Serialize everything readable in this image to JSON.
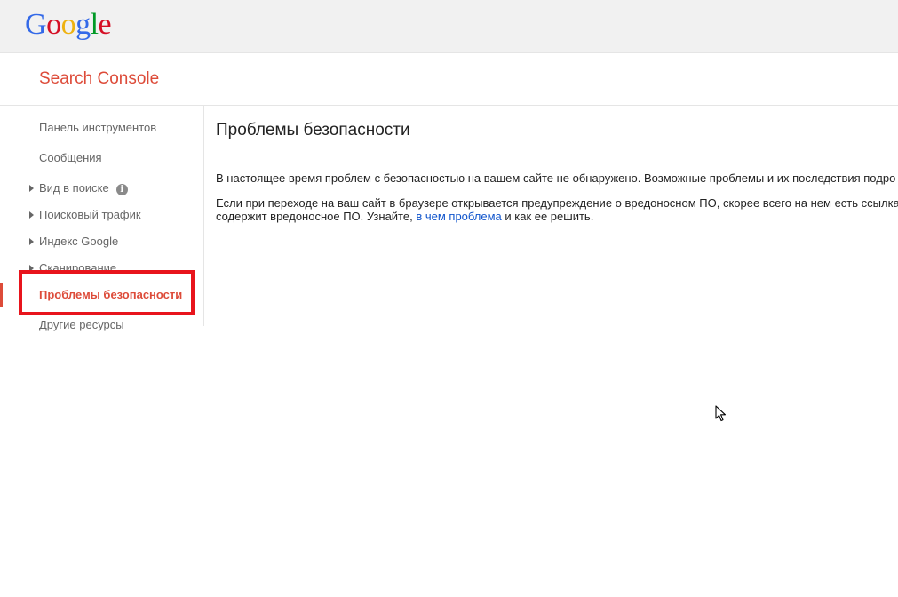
{
  "logo": {
    "letters": [
      "G",
      "o",
      "o",
      "g",
      "l",
      "e"
    ],
    "colors": [
      "#3369e8",
      "#d50f25",
      "#eeb211",
      "#3369e8",
      "#009925",
      "#d50f25"
    ]
  },
  "header": {
    "product_title": "Search Console"
  },
  "sidebar": {
    "items": [
      {
        "label": "Панель инструментов"
      },
      {
        "label": "Сообщения"
      },
      {
        "label": "Вид в поиске",
        "info_icon": "i"
      },
      {
        "label": "Поисковый трафик"
      },
      {
        "label": "Индекс Google"
      },
      {
        "label": "Сканирование"
      },
      {
        "label": "Проблемы безопасности"
      },
      {
        "label": "Другие ресурсы"
      }
    ],
    "active_index": 6
  },
  "main": {
    "title": "Проблемы безопасности",
    "paragraph1": "В настоящее время проблем с безопасностью на вашем сайте не обнаружено. Возможные проблемы и их последствия подро",
    "paragraph2_line1": "Если при переходе на ваш сайт в браузере открывается предупреждение о вредоносном ПО, скорее всего на нем есть ссылка",
    "paragraph2_line2_before": "содержит вредоносное ПО. Узнайте, ",
    "paragraph2_link": "в чем проблема",
    "paragraph2_line2_after": " и как ее решить."
  },
  "colors": {
    "brand_red": "#dd4b39",
    "highlight_red": "#e8141c",
    "link_blue": "#1155cc",
    "topbar_bg": "#f1f1f1"
  }
}
